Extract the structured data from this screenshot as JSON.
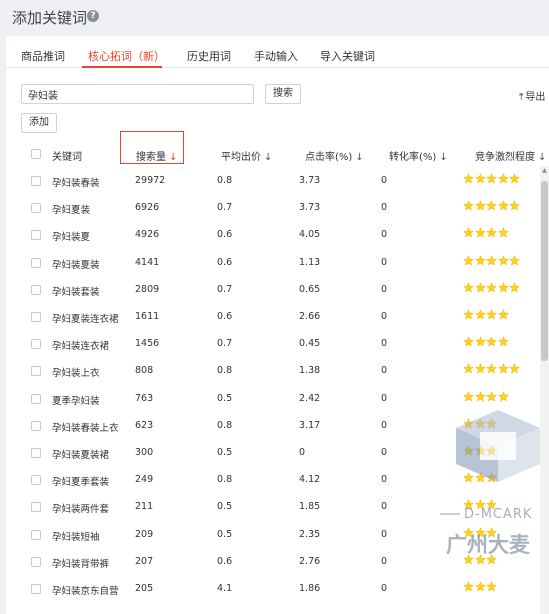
{
  "page": {
    "title": "添加关键词"
  },
  "tabs": [
    {
      "label": "商品推词",
      "active": false
    },
    {
      "label": "核心拓词（新）",
      "active": true
    },
    {
      "label": "历史用词",
      "active": false
    },
    {
      "label": "手动输入",
      "active": false
    },
    {
      "label": "导入关键词",
      "active": false
    }
  ],
  "search": {
    "value": "孕妇装",
    "button_label": "搜索"
  },
  "toolbar": {
    "add_label": "添加",
    "export_label": "导出"
  },
  "colors": {
    "accent": "#e8452a",
    "star": "#ffd11a"
  },
  "table": {
    "headers": {
      "keyword": "关键词",
      "search_volume": "搜索量",
      "avg_bid": "平均出价",
      "ctr": "点击率(%)",
      "cvr": "转化率(%)",
      "competition": "竞争激烈程度"
    },
    "sort_arrow": "↓",
    "rows": [
      {
        "keyword": "孕妇装春装",
        "volume": "29972",
        "bid": "0.8",
        "ctr": "3.73",
        "cvr": "0",
        "stars": 5
      },
      {
        "keyword": "孕妇夏装",
        "volume": "6926",
        "bid": "0.7",
        "ctr": "3.73",
        "cvr": "0",
        "stars": 5
      },
      {
        "keyword": "孕妇装夏",
        "volume": "4926",
        "bid": "0.6",
        "ctr": "4.05",
        "cvr": "0",
        "stars": 4
      },
      {
        "keyword": "孕妇装夏装",
        "volume": "4141",
        "bid": "0.6",
        "ctr": "1.13",
        "cvr": "0",
        "stars": 5
      },
      {
        "keyword": "孕妇装套装",
        "volume": "2809",
        "bid": "0.7",
        "ctr": "0.65",
        "cvr": "0",
        "stars": 5
      },
      {
        "keyword": "孕妇夏装连衣裙",
        "volume": "1611",
        "bid": "0.6",
        "ctr": "2.66",
        "cvr": "0",
        "stars": 4
      },
      {
        "keyword": "孕妇装连衣裙",
        "volume": "1456",
        "bid": "0.7",
        "ctr": "0.45",
        "cvr": "0",
        "stars": 4
      },
      {
        "keyword": "孕妇装上衣",
        "volume": "808",
        "bid": "0.8",
        "ctr": "1.38",
        "cvr": "0",
        "stars": 5
      },
      {
        "keyword": "夏季孕妇装",
        "volume": "763",
        "bid": "0.5",
        "ctr": "2.42",
        "cvr": "0",
        "stars": 4
      },
      {
        "keyword": "孕妇装春装上衣",
        "volume": "623",
        "bid": "0.8",
        "ctr": "3.17",
        "cvr": "0",
        "stars": 3
      },
      {
        "keyword": "孕妇装夏装裙",
        "volume": "300",
        "bid": "0.5",
        "ctr": "0",
        "cvr": "0",
        "stars": 3
      },
      {
        "keyword": "孕妇夏季套装",
        "volume": "249",
        "bid": "0.8",
        "ctr": "4.12",
        "cvr": "0",
        "stars": 3
      },
      {
        "keyword": "孕妇装两件套",
        "volume": "211",
        "bid": "0.5",
        "ctr": "1.85",
        "cvr": "0",
        "stars": 3
      },
      {
        "keyword": "孕妇装短袖",
        "volume": "209",
        "bid": "0.5",
        "ctr": "2.35",
        "cvr": "0",
        "stars": 3
      },
      {
        "keyword": "孕妇装背带裤",
        "volume": "207",
        "bid": "0.6",
        "ctr": "2.76",
        "cvr": "0",
        "stars": 3
      },
      {
        "keyword": "孕妇装京东自营",
        "volume": "205",
        "bid": "4.1",
        "ctr": "1.86",
        "cvr": "0",
        "stars": 3
      }
    ]
  },
  "watermark": {
    "brand": "D-MCARK",
    "name": "广州大麦"
  }
}
